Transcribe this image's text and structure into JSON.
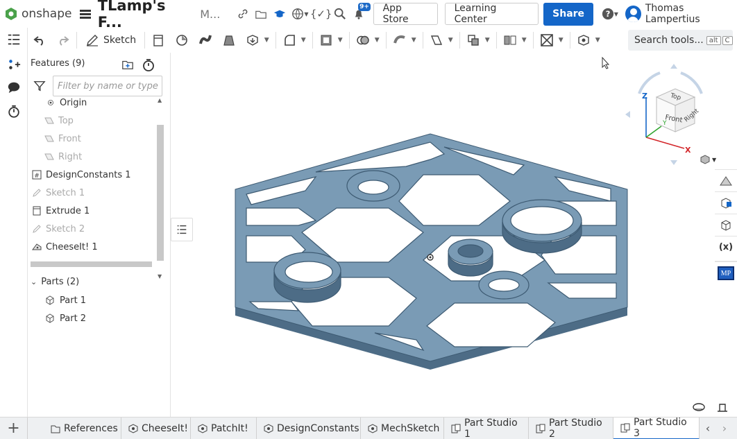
{
  "app": {
    "logo_text": "onshape",
    "doc_title": "TLamp's F...",
    "doc_subtitle": "M..."
  },
  "topbar": {
    "notification_count": "9+",
    "app_store_label": "App Store",
    "learning_center_label": "Learning Center",
    "share_label": "Share",
    "user_name": "Thomas Lampertius"
  },
  "toolbar": {
    "sketch_label": "Sketch",
    "search_label": "Search tools...",
    "search_key1": "alt",
    "search_key2": "C"
  },
  "features": {
    "header": "Features (9)",
    "filter_placeholder": "Filter by name or type",
    "items": [
      {
        "label": "Origin",
        "dim": false
      },
      {
        "label": "Top",
        "dim": true
      },
      {
        "label": "Front",
        "dim": true
      },
      {
        "label": "Right",
        "dim": true
      },
      {
        "label": "DesignConstants 1",
        "dim": false
      },
      {
        "label": "Sketch 1",
        "dim": true
      },
      {
        "label": "Extrude 1",
        "dim": false
      },
      {
        "label": "Sketch 2",
        "dim": true
      },
      {
        "label": "CheeseIt! 1",
        "dim": false
      }
    ]
  },
  "parts": {
    "header": "Parts (2)",
    "items": [
      "Part 1",
      "Part 2"
    ]
  },
  "viewcube": {
    "top": "Top",
    "front": "Front",
    "right": "Right",
    "axis_z": "Z",
    "axis_x": "X",
    "axis_y": "Y"
  },
  "tabs": [
    {
      "label": "References",
      "active": false
    },
    {
      "label": "CheeseIt!",
      "active": false
    },
    {
      "label": "PatchIt!",
      "active": false
    },
    {
      "label": "DesignConstants",
      "active": false
    },
    {
      "label": "MechSketch",
      "active": false
    },
    {
      "label": "Part Studio 1",
      "active": false
    },
    {
      "label": "Part Studio 2",
      "active": false
    },
    {
      "label": "Part Studio 3",
      "active": true
    }
  ],
  "colors": {
    "accent": "#1466c8",
    "part_top": "#7a9bb5",
    "part_side": "#4d6c86"
  }
}
